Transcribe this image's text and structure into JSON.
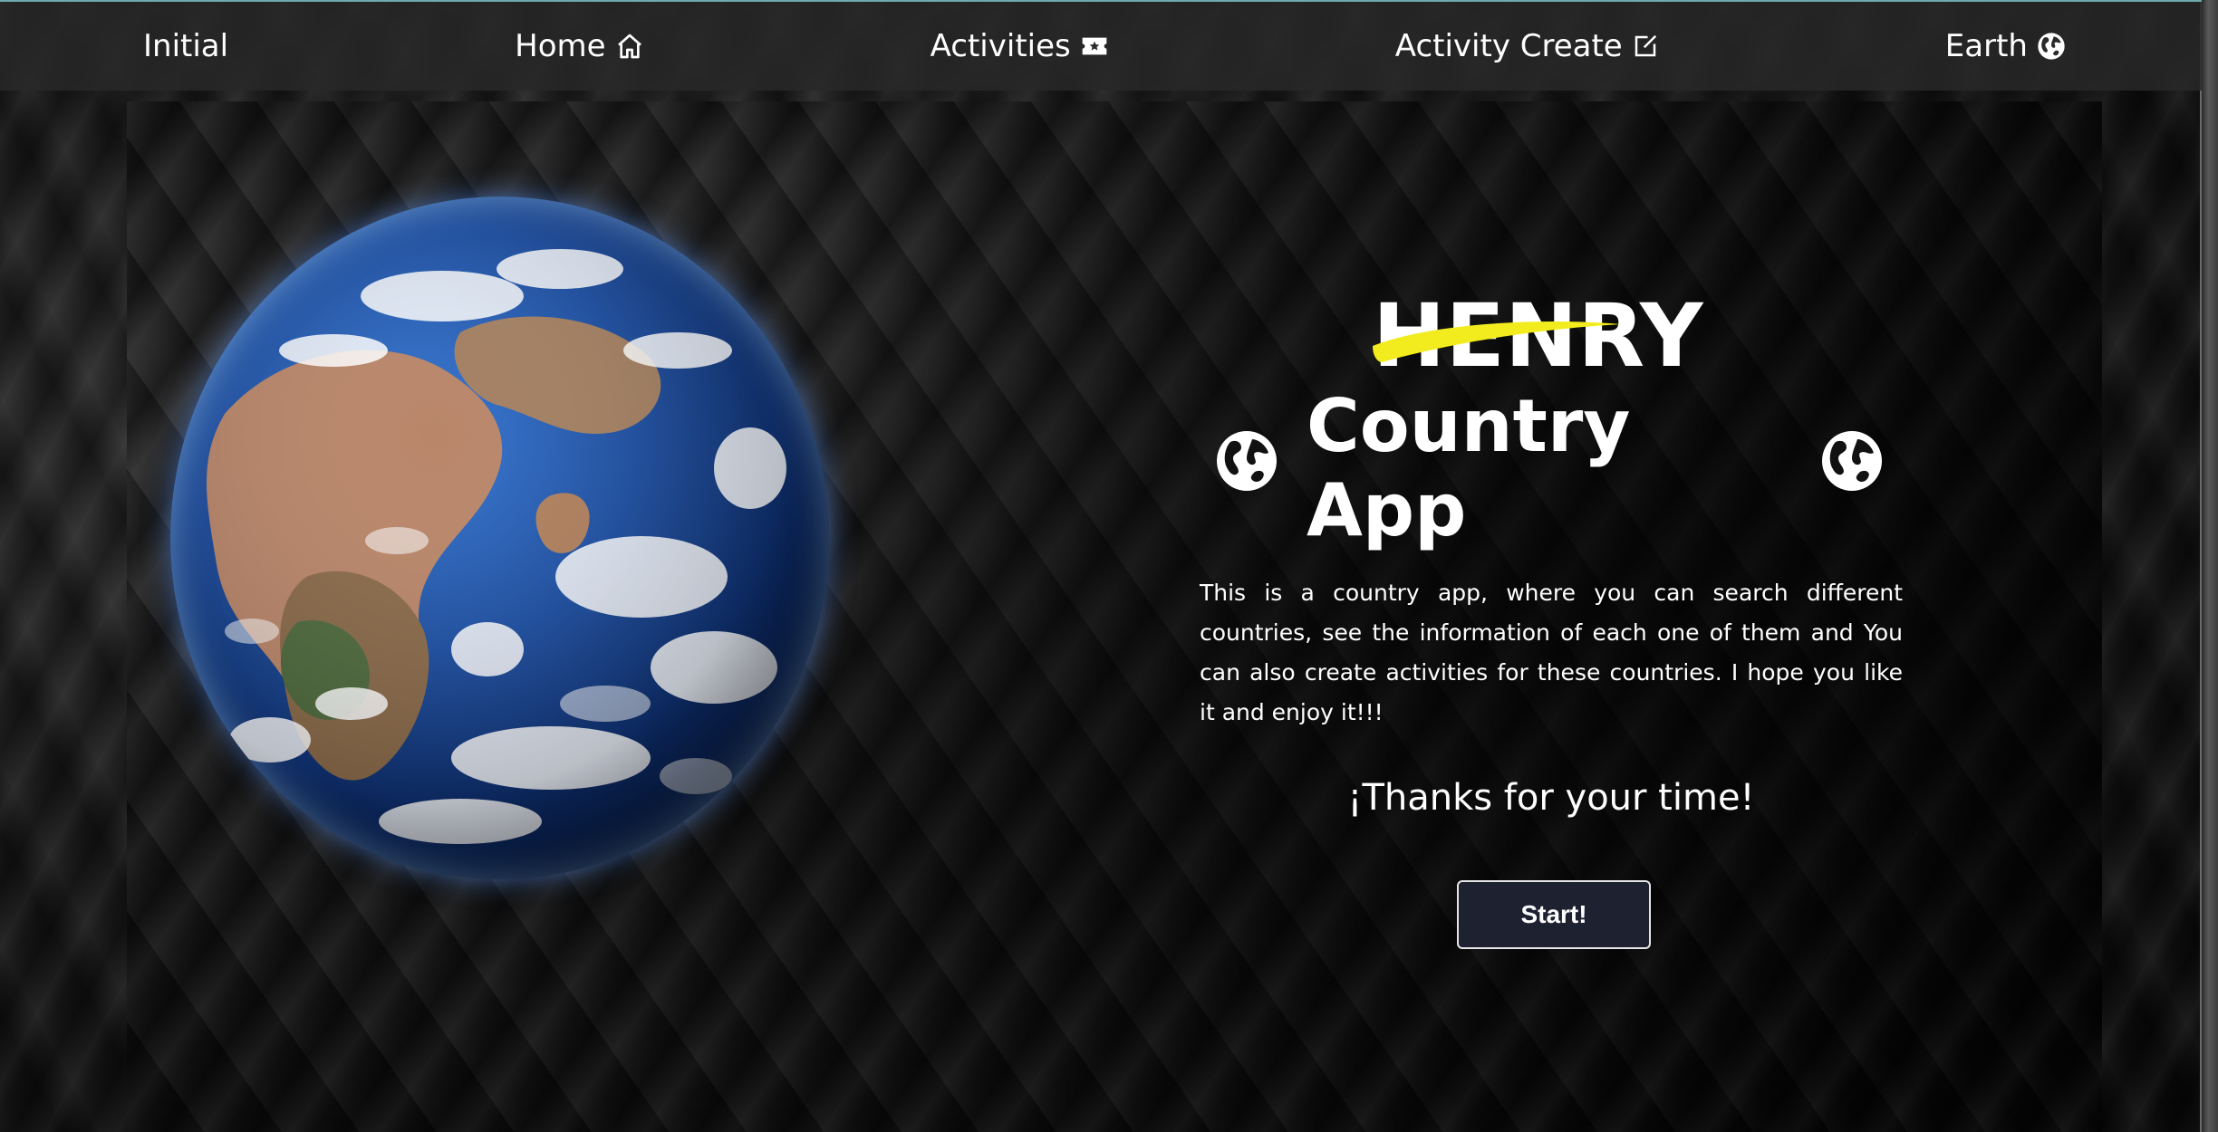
{
  "nav": {
    "items": [
      {
        "label": "Initial",
        "icon": ""
      },
      {
        "label": "Home",
        "icon": "house-icon"
      },
      {
        "label": "Activities",
        "icon": "ticket-icon"
      },
      {
        "label": "Activity Create",
        "icon": "edit-icon"
      },
      {
        "label": "Earth",
        "icon": "globe-icon"
      }
    ]
  },
  "hero": {
    "logo_text": "HENRY",
    "title": "Country App",
    "description": "This is a country app, where you can search different countries, see the information of each one of them and You can also create activities for these countries. I hope you like it and enjoy it!!!",
    "thanks": "¡Thanks for your time!",
    "start_label": "Start!"
  },
  "colors": {
    "accent_yellow": "#f2ec1f",
    "button_bg": "#1e2130",
    "nav_bg": "#282828"
  }
}
